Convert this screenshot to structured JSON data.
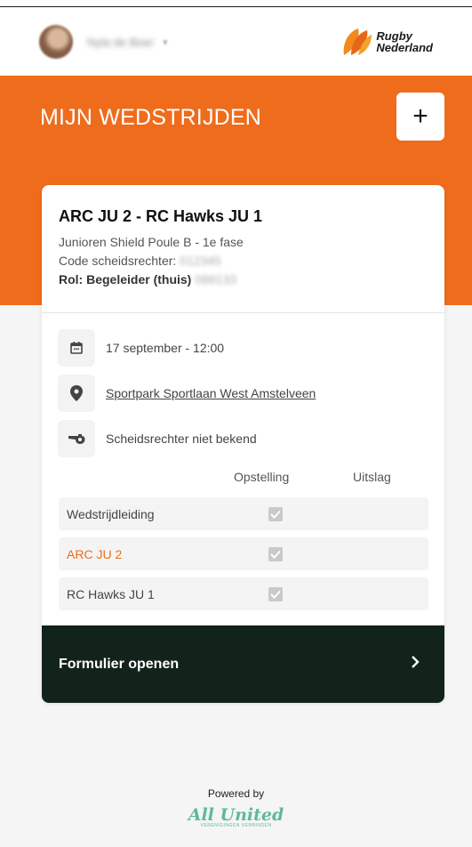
{
  "header": {
    "username": "Nyla de Boer",
    "logo_line1": "Rugby",
    "logo_line2": "Nederland"
  },
  "page": {
    "title": "MIJN WEDSTRIJDEN",
    "add_label": "+"
  },
  "match": {
    "title": "ARC JU 2 - RC Hawks JU 1",
    "competition": "Junioren Shield Poule B - 1e fase",
    "referee_code_label": "Code scheidsrechter:",
    "referee_code_value": "012345",
    "role_label": "Rol: Begeleider (thuis)",
    "role_value": "088133",
    "datetime": "17 september - 12:00",
    "location": "Sportpark Sportlaan West Amstelveen",
    "referee": "Scheidsrechter niet bekend"
  },
  "table": {
    "headers": [
      "Opstelling",
      "Uitslag"
    ],
    "rows": [
      {
        "label": "Wedstrijdleiding",
        "opstelling": true
      },
      {
        "label": "ARC JU 2",
        "opstelling": true
      },
      {
        "label": "RC Hawks JU 1",
        "opstelling": true
      }
    ]
  },
  "action": {
    "form_label": "Formulier openen"
  },
  "footer": {
    "powered_by": "Powered by",
    "brand": "All United",
    "brand_sub": "VERENIGINGEN VERBINDEN"
  },
  "colors": {
    "accent": "#ee6c1c",
    "dark_button": "#12231b"
  },
  "icons": [
    "calendar-icon",
    "location-pin-icon",
    "whistle-icon",
    "checkbox-icon",
    "chevron-right-icon",
    "plus-icon"
  ]
}
